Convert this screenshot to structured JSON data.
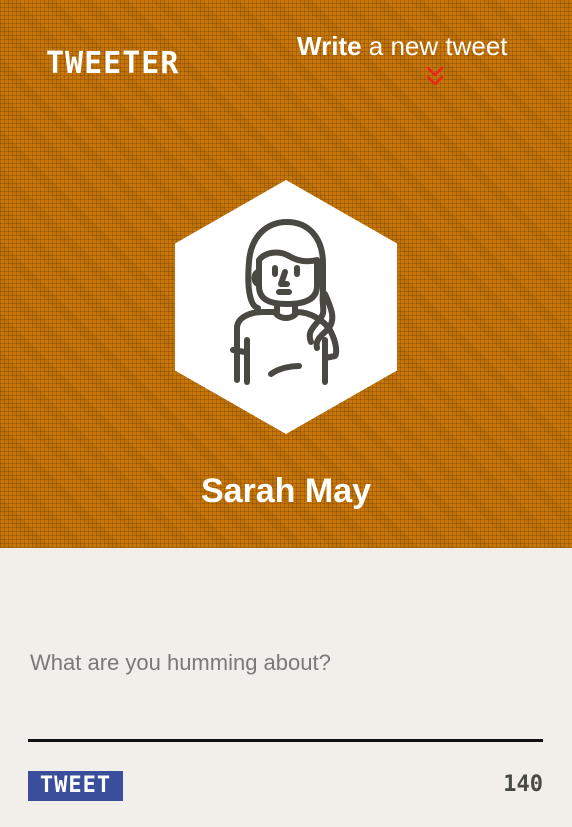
{
  "header": {
    "logo_text": "TWEETER",
    "write_link": {
      "bold_part": "Write",
      "rest": " a new tweet"
    },
    "chevron_icon": "double-chevron-down-icon",
    "background_color": "#c8760a"
  },
  "profile": {
    "avatar_icon": "woman-avatar-icon",
    "name": "Sarah May"
  },
  "compose": {
    "placeholder": "What are you humming about?",
    "value": "",
    "tweet_button_label": "TWEET",
    "char_count": "140",
    "button_color": "#3a4e9c"
  },
  "colors": {
    "accent_chevron": "#e8261a",
    "compose_background": "#f2efea"
  }
}
